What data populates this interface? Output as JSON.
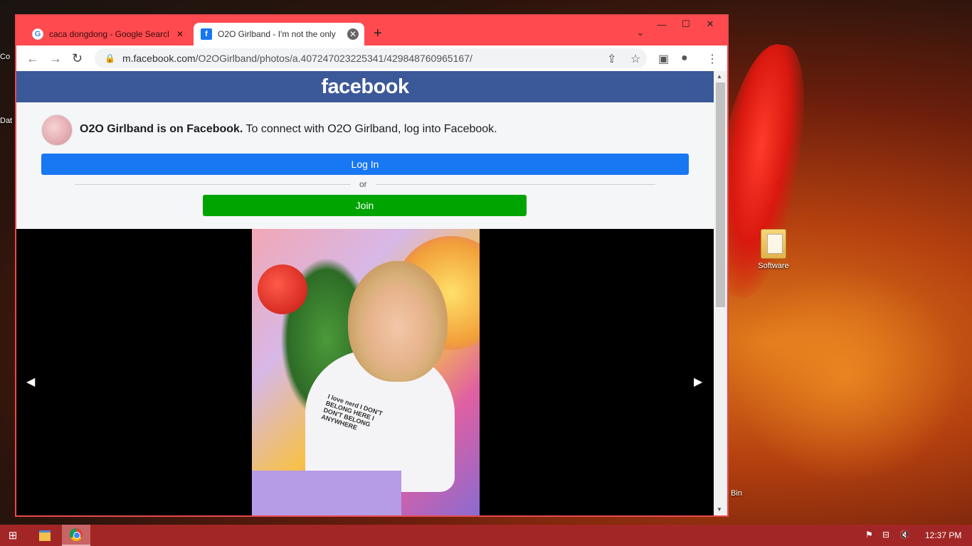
{
  "desktop": {
    "icons": [
      {
        "label": "Software",
        "icon": "folder-icon"
      },
      {
        "label": "Bin",
        "icon": "recycle-bin-icon"
      }
    ],
    "left_edge_labels": [
      "Co",
      "Dat"
    ]
  },
  "browser": {
    "tabs": [
      {
        "title": "caca dongdong - Google Search",
        "favicon": "google-icon",
        "active": false
      },
      {
        "title": "O2O Girlband - I'm not the only",
        "favicon": "facebook-icon",
        "active": true
      }
    ],
    "new_tab_label": "+",
    "window_controls": {
      "minimize": "—",
      "maximize": "☐",
      "close": "✕",
      "tab_search": "⌄"
    },
    "url_host": "m.facebook.com",
    "url_path": "/O2OGirlband/photos/a.407247023225341/429848760965167/"
  },
  "page": {
    "brand": "facebook",
    "connect_bold": "O2O Girlband is on Facebook.",
    "connect_rest": " To connect with O2O Girlband, log into Facebook.",
    "login_label": "Log In",
    "or_label": "or",
    "join_label": "Join",
    "shirt_text": "I love nerd I DON'T BELONG HERE I DON'T BELONG ANYWHERE",
    "colors": {
      "fb_header": "#3b5998",
      "login": "#1877f2",
      "join": "#00a400"
    }
  },
  "taskbar": {
    "clock": "12:37 PM",
    "pinned": [
      "start-icon",
      "file-explorer-icon",
      "chrome-icon"
    ],
    "tray": [
      "action-center-flag-icon",
      "network-icon",
      "volume-muted-icon"
    ]
  }
}
